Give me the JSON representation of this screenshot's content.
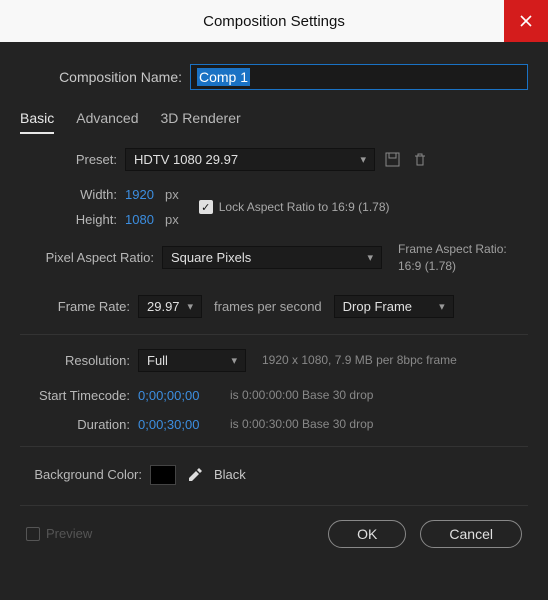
{
  "titlebar": {
    "title": "Composition Settings"
  },
  "compName": {
    "label": "Composition Name:",
    "value": "Comp 1"
  },
  "tabs": {
    "basic": "Basic",
    "advanced": "Advanced",
    "renderer": "3D Renderer"
  },
  "preset": {
    "label": "Preset:",
    "value": "HDTV 1080 29.97"
  },
  "width": {
    "label": "Width:",
    "value": "1920",
    "unit": "px"
  },
  "height": {
    "label": "Height:",
    "value": "1080",
    "unit": "px"
  },
  "lock": {
    "label": "Lock Aspect Ratio to 16:9 (1.78)"
  },
  "par": {
    "label": "Pixel Aspect Ratio:",
    "value": "Square Pixels"
  },
  "far": {
    "line1": "Frame Aspect Ratio:",
    "line2": "16:9 (1.78)"
  },
  "frameRate": {
    "label": "Frame Rate:",
    "value": "29.97",
    "fpsText": "frames per second",
    "drop": "Drop Frame"
  },
  "resolution": {
    "label": "Resolution:",
    "value": "Full",
    "info": "1920 x 1080, 7.9 MB per 8bpc frame"
  },
  "startTC": {
    "label": "Start Timecode:",
    "value": "0;00;00;00",
    "info": "is 0:00:00:00 Base 30 drop"
  },
  "duration": {
    "label": "Duration:",
    "value": "0;00;30;00",
    "info": "is 0:00:30:00 Base 30 drop"
  },
  "bg": {
    "label": "Background Color:",
    "name": "Black"
  },
  "footer": {
    "preview": "Preview",
    "ok": "OK",
    "cancel": "Cancel"
  }
}
